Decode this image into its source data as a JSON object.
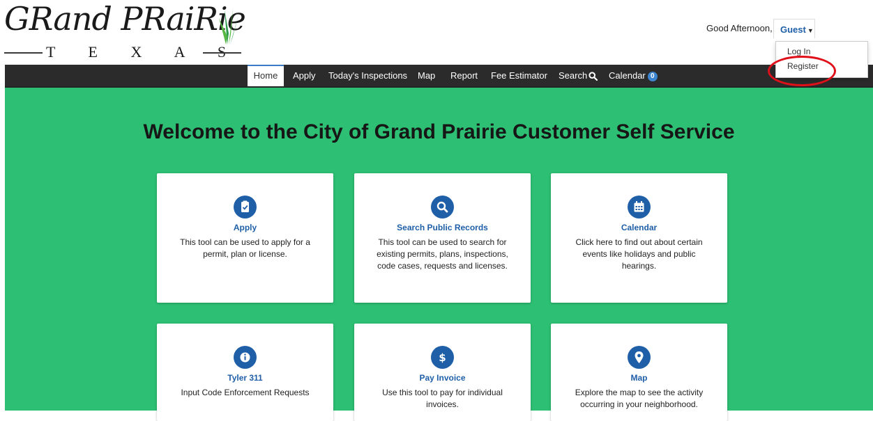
{
  "header": {
    "logo": {
      "wordmark": "GRand PRaiRie",
      "state": "T E X A S"
    },
    "greeting": "Good Afternoon,",
    "user_menu": {
      "label": "Guest",
      "items": [
        "Log In",
        "Register"
      ]
    }
  },
  "nav": {
    "items": [
      "Home",
      "Apply",
      "Today's Inspections",
      "Map",
      "Report",
      "Fee Estimator",
      "Search",
      "Calendar"
    ],
    "active": "Home",
    "calendar_badge": "0"
  },
  "main": {
    "title": "Welcome to the City of Grand Prairie Customer Self Service",
    "cards": [
      {
        "title": "Apply",
        "desc": "This tool can be used to apply for a permit, plan or license.",
        "icon": "clipboard-check-icon"
      },
      {
        "title": "Search Public Records",
        "desc": "This tool can be used to search for existing permits, plans, inspections, code cases, requests and licenses.",
        "icon": "search-icon"
      },
      {
        "title": "Calendar",
        "desc": "Click here to find out about certain events like holidays and public hearings.",
        "icon": "calendar-icon"
      },
      {
        "title": "Tyler 311",
        "desc": "Input Code Enforcement Requests",
        "icon": "info-icon"
      },
      {
        "title": "Pay Invoice",
        "desc": "Use this tool to pay for individual invoices.",
        "icon": "dollar-icon"
      },
      {
        "title": "Map",
        "desc": "Explore the map to see the activity occurring in your neighborhood.",
        "icon": "map-marker-icon"
      }
    ]
  },
  "colors": {
    "main_bg": "#2dbf73",
    "navbar_bg": "#2b2b2b",
    "accent_blue": "#1f5fa8",
    "highlight_red": "#e0101a"
  }
}
